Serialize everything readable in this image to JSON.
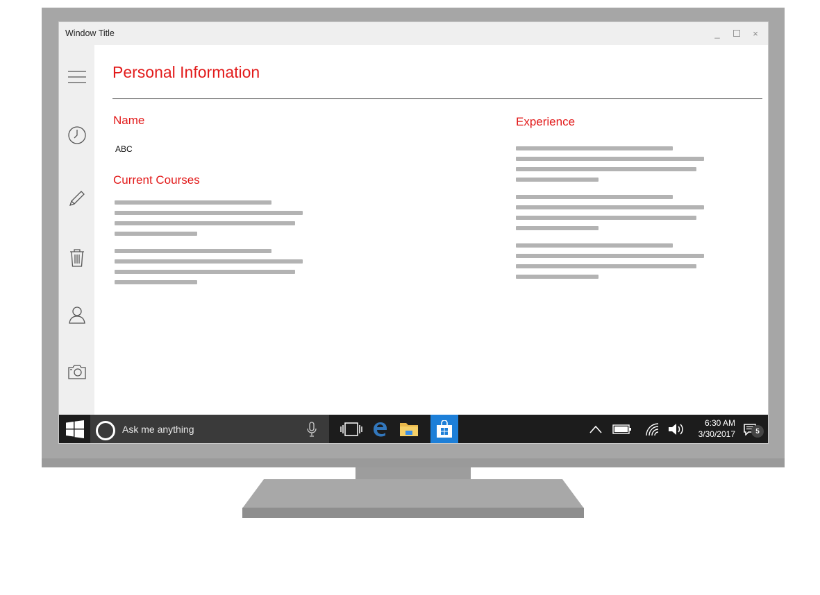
{
  "window": {
    "title": "Window Title",
    "minimize": "_",
    "close": "×"
  },
  "sidebar": {
    "items": [
      {
        "name": "menu",
        "icon": "hamburger-icon"
      },
      {
        "name": "history",
        "icon": "clock-icon"
      },
      {
        "name": "edit",
        "icon": "pencil-icon"
      },
      {
        "name": "delete",
        "icon": "trash-icon"
      },
      {
        "name": "profile",
        "icon": "person-icon"
      },
      {
        "name": "camera",
        "icon": "camera-icon"
      }
    ]
  },
  "main": {
    "page_title": "Personal Information",
    "name_label": "Name",
    "name_value": "ABC",
    "courses_label": "Current Courses",
    "experience_label": "Experience"
  },
  "taskbar": {
    "search_placeholder": "Ask me anything",
    "time": "6:30 AM",
    "date": "3/30/2017",
    "notification_count": "5"
  },
  "colors": {
    "accent": "#e21a1a",
    "taskbar": "#1c1c1c",
    "store_active": "#1d7fd8"
  }
}
